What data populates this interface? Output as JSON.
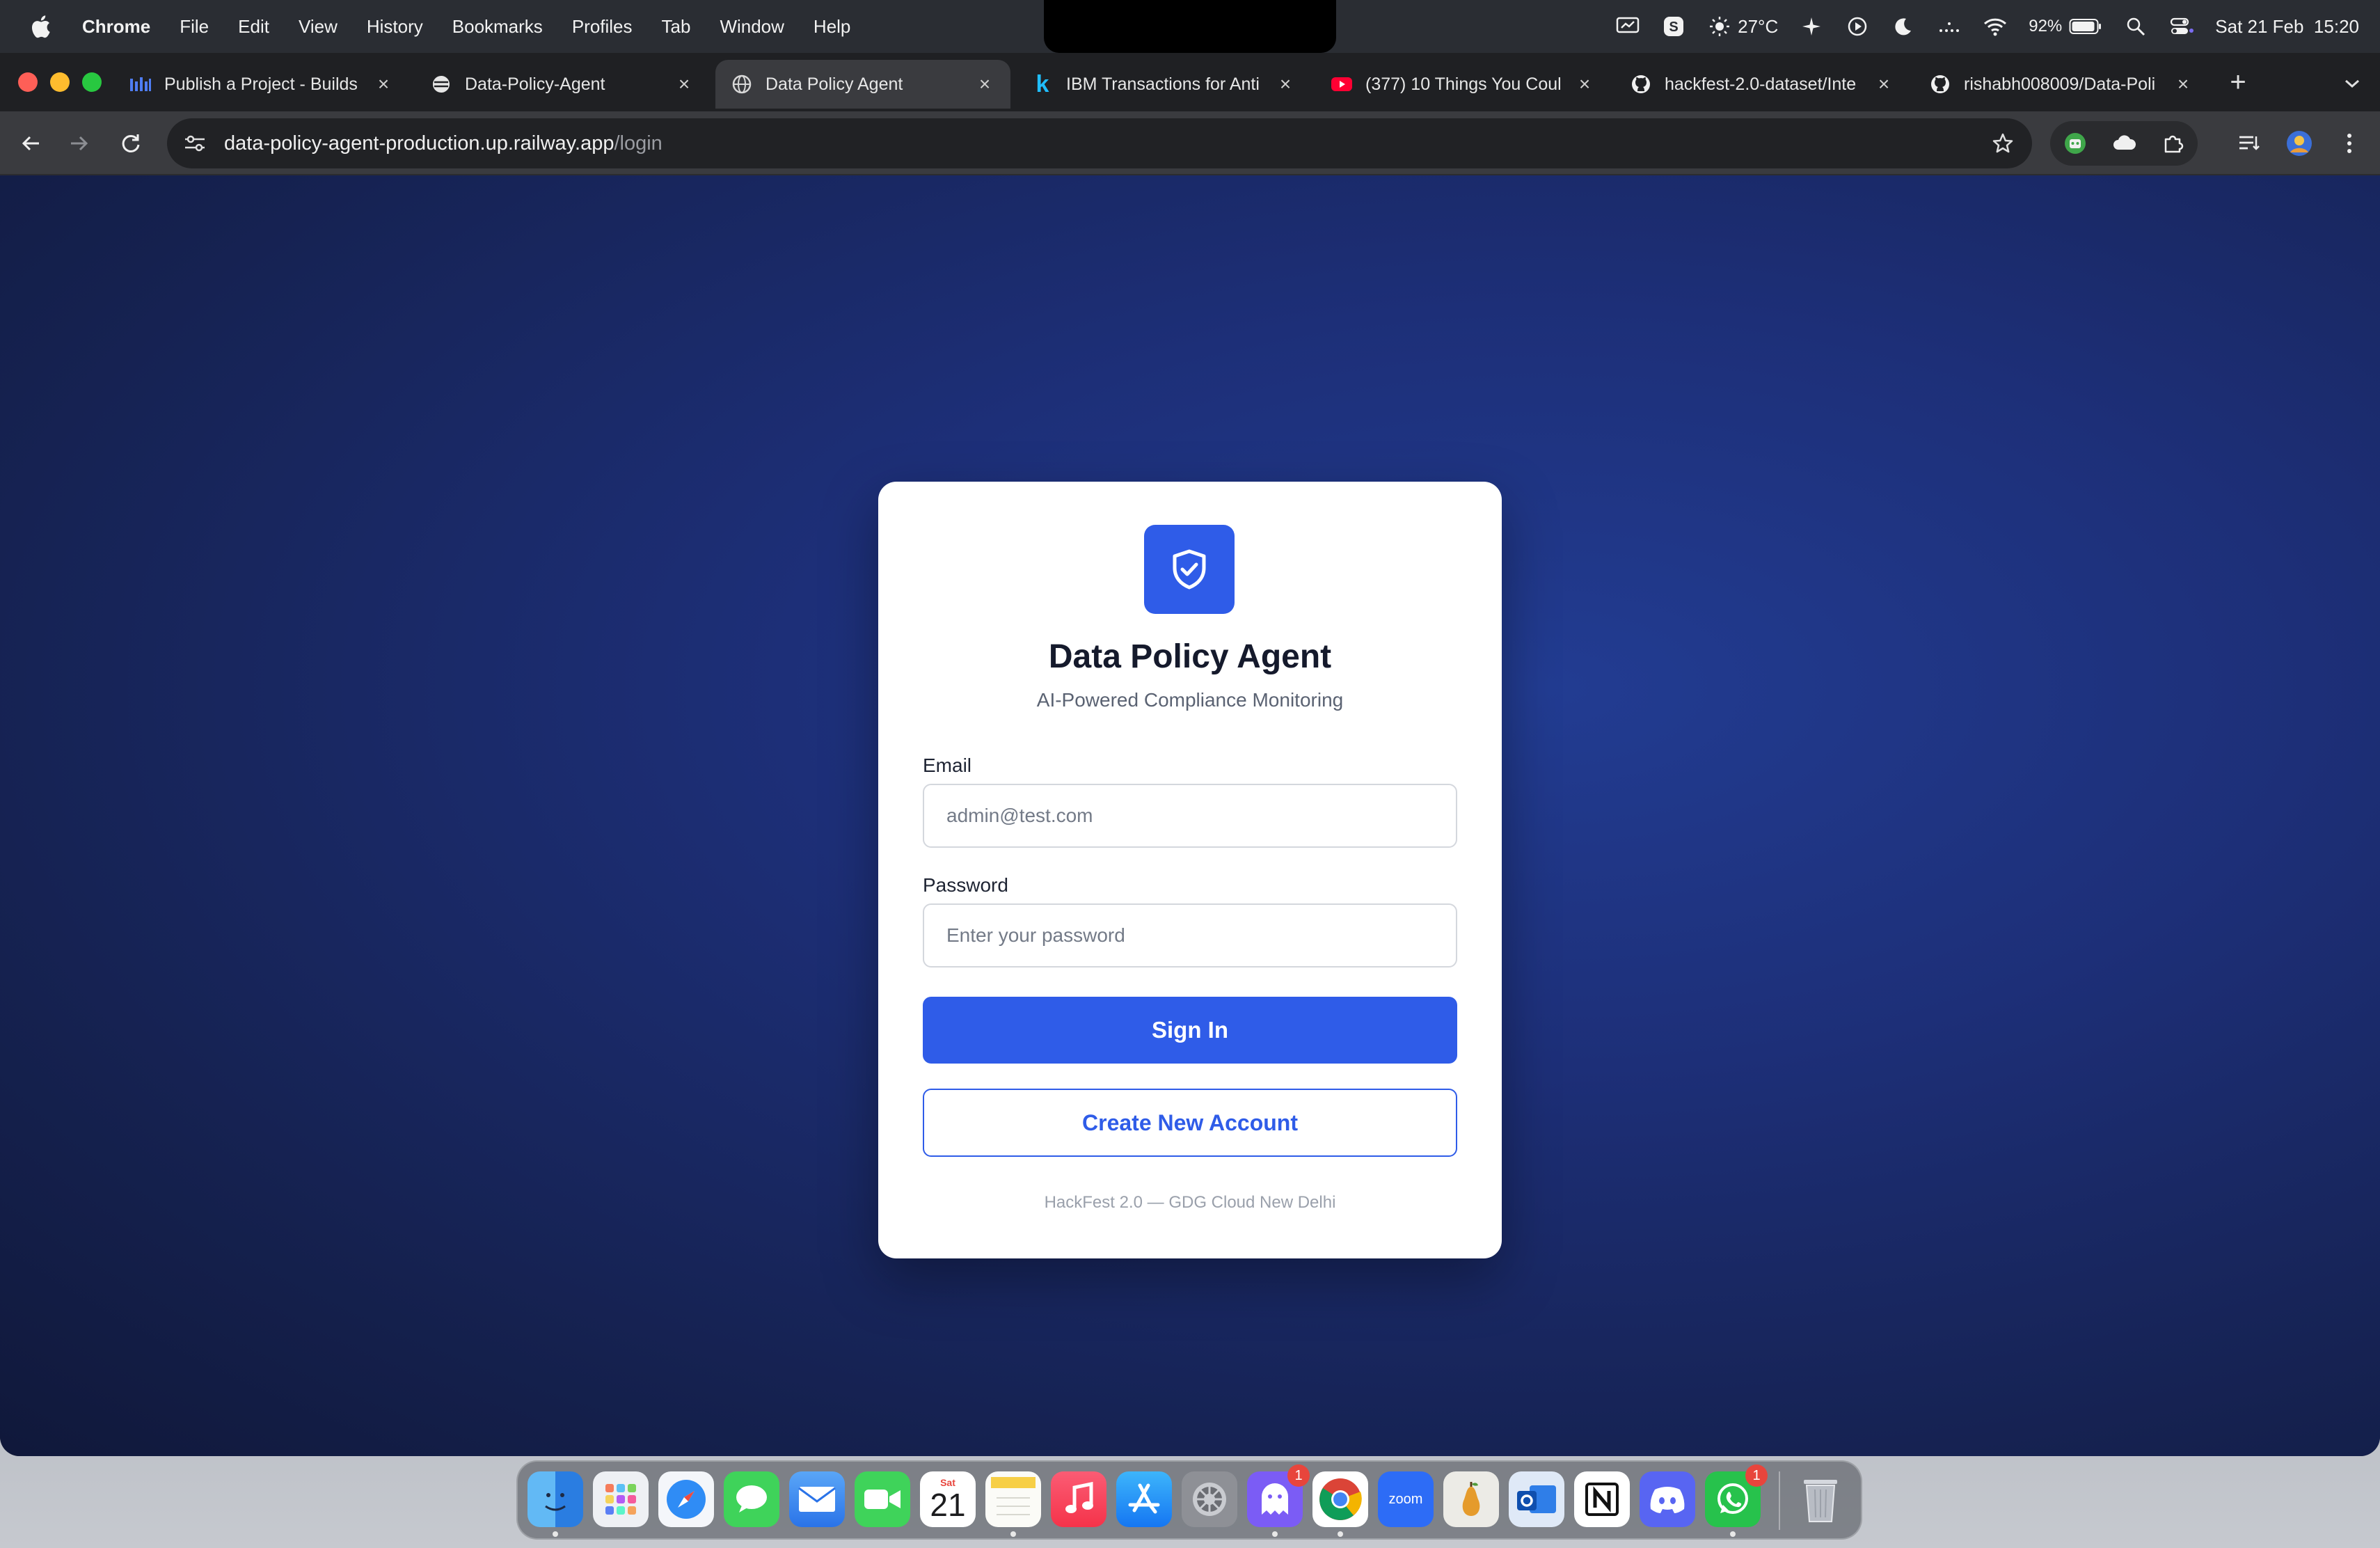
{
  "menubar": {
    "app_name": "Chrome",
    "items": [
      "File",
      "Edit",
      "View",
      "History",
      "Bookmarks",
      "Profiles",
      "Tab",
      "Window",
      "Help"
    ],
    "status": {
      "temperature": "27°C",
      "battery": "92%",
      "datetime": "Sat 21 Feb  15:20"
    }
  },
  "browser": {
    "tabs": [
      {
        "title": "Publish a Project - Builds",
        "icon": "builds-icon",
        "active": false
      },
      {
        "title": "Data-Policy-Agent",
        "icon": "globe-icon",
        "active": false
      },
      {
        "title": "Data Policy Agent",
        "icon": "globe-icon",
        "active": true
      },
      {
        "title": "IBM Transactions for Anti",
        "icon": "kaggle-icon",
        "active": false
      },
      {
        "title": "(377) 10 Things You Coul",
        "icon": "youtube-icon",
        "active": false
      },
      {
        "title": "hackfest-2.0-dataset/Inte",
        "icon": "github-icon",
        "active": false
      },
      {
        "title": "rishabh008009/Data-Poli",
        "icon": "github-icon",
        "active": false
      }
    ],
    "url_host": "data-policy-agent-production.up.railway.app",
    "url_path": "/login"
  },
  "login": {
    "title": "Data Policy Agent",
    "subtitle": "AI-Powered Compliance Monitoring",
    "email_label": "Email",
    "email_placeholder": "admin@test.com",
    "email_value": "",
    "password_label": "Password",
    "password_placeholder": "Enter your password",
    "password_value": "",
    "sign_in_label": "Sign In",
    "create_account_label": "Create New Account",
    "footer": "HackFest 2.0 — GDG Cloud New Delhi"
  },
  "dock": {
    "calendar_day": "Sat",
    "calendar_date": "21",
    "zoom_label": "zoom",
    "badges": {
      "ghost": "1",
      "whatsapp": "1"
    },
    "apps": [
      "finder",
      "launchpad",
      "safari",
      "messages",
      "mail",
      "facetime",
      "calendar",
      "notes",
      "music",
      "app-store",
      "system-settings",
      "ghost",
      "chrome",
      "zoom",
      "pear",
      "outlook",
      "notion",
      "discord",
      "whatsapp",
      "trash"
    ]
  },
  "colors": {
    "accent": "#2f5ce8",
    "page_bg": "#1d2f78",
    "card_bg": "#ffffff",
    "title_text": "#151a2c"
  }
}
